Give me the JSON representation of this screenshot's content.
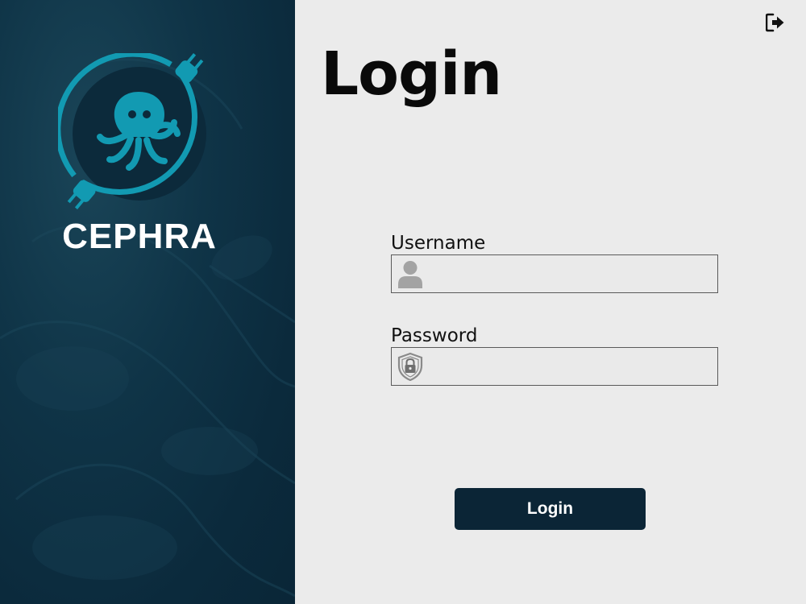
{
  "brand": {
    "name": "CEPHRA",
    "accent_color": "#129ab2",
    "panel_color": "#0f3447",
    "logo_icon": "octopus-plug-icon"
  },
  "header": {
    "title": "Login",
    "exit_icon": "exit-icon"
  },
  "form": {
    "username": {
      "label": "Username",
      "value": "",
      "placeholder": "",
      "icon": "user-icon"
    },
    "password": {
      "label": "Password",
      "value": "",
      "placeholder": "",
      "icon": "shield-lock-icon"
    },
    "submit_label": "Login"
  }
}
